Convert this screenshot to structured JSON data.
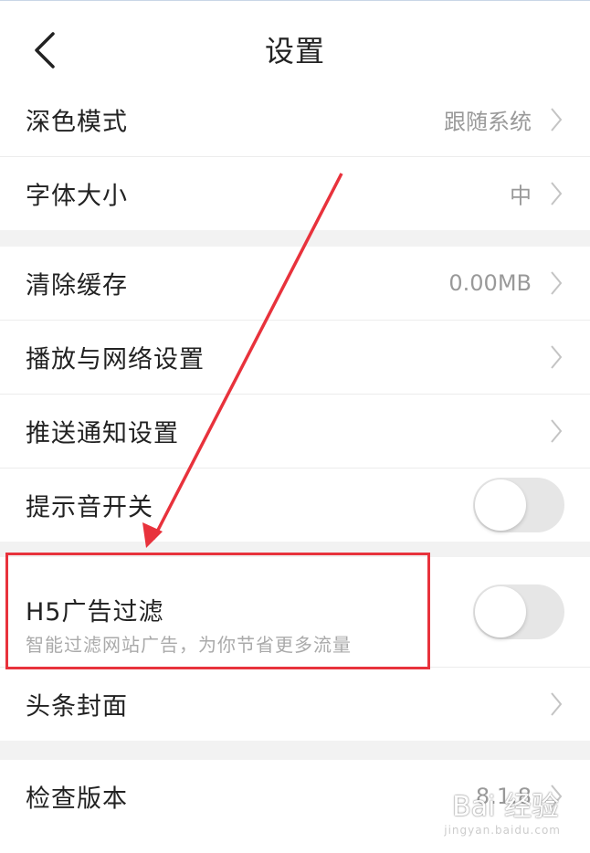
{
  "header": {
    "title": "设置"
  },
  "group1": [
    {
      "label": "深色模式",
      "value": "跟随系统"
    },
    {
      "label": "字体大小",
      "value": "中"
    }
  ],
  "group2": [
    {
      "label": "清除缓存",
      "value": "0.00MB"
    },
    {
      "label": "播放与网络设置",
      "value": ""
    },
    {
      "label": "推送通知设置",
      "value": ""
    },
    {
      "label": "提示音开关",
      "toggle_on": false
    }
  ],
  "group3": {
    "ad_filter": {
      "label": "H5广告过滤",
      "desc": "智能过滤网站广告，为你节省更多流量",
      "toggle_on": false
    },
    "cover": {
      "label": "头条封面"
    }
  },
  "group4": [
    {
      "label": "检查版本",
      "value": "8.1.8"
    }
  ],
  "annotation": {
    "highlight_color": "#e8323c"
  },
  "watermark": {
    "text": "Bai 经验",
    "sub": "jingyan.baidu.com"
  }
}
